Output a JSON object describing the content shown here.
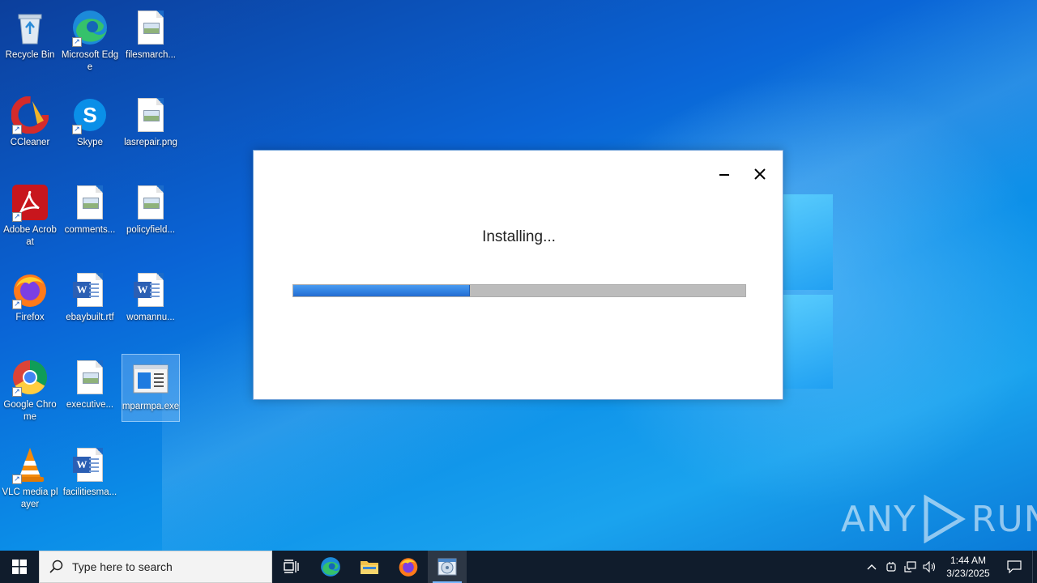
{
  "desktop": {
    "icons": [
      {
        "label": "Recycle Bin"
      },
      {
        "label": "Microsoft Edge"
      },
      {
        "label": "filesmarch..."
      },
      {
        "label": "CCleaner"
      },
      {
        "label": "Skype"
      },
      {
        "label": "lasrepair.png"
      },
      {
        "label": "Adobe Acrobat"
      },
      {
        "label": "comments..."
      },
      {
        "label": "policyfield..."
      },
      {
        "label": "Firefox"
      },
      {
        "label": "ebaybuilt.rtf"
      },
      {
        "label": "womannu..."
      },
      {
        "label": "Google Chrome"
      },
      {
        "label": "executive..."
      },
      {
        "label": "mparmpa.exe"
      },
      {
        "label": "VLC media player"
      },
      {
        "label": "facilitiesma..."
      }
    ]
  },
  "installer": {
    "status_text": "Installing...",
    "progress_fraction": 0.39
  },
  "watermark": {
    "left": "ANY",
    "right": "RUN"
  },
  "taskbar": {
    "search_placeholder": "Type here to search",
    "apps": [
      "task-view",
      "microsoft-edge",
      "file-explorer",
      "firefox",
      "installer-app"
    ],
    "clock": {
      "time": "1:44 AM",
      "date": "3/23/2025"
    }
  },
  "colors": {
    "taskbar": "#101c2c",
    "progress_fill": "#2f7fe0",
    "progress_track": "#bcbcbc"
  }
}
